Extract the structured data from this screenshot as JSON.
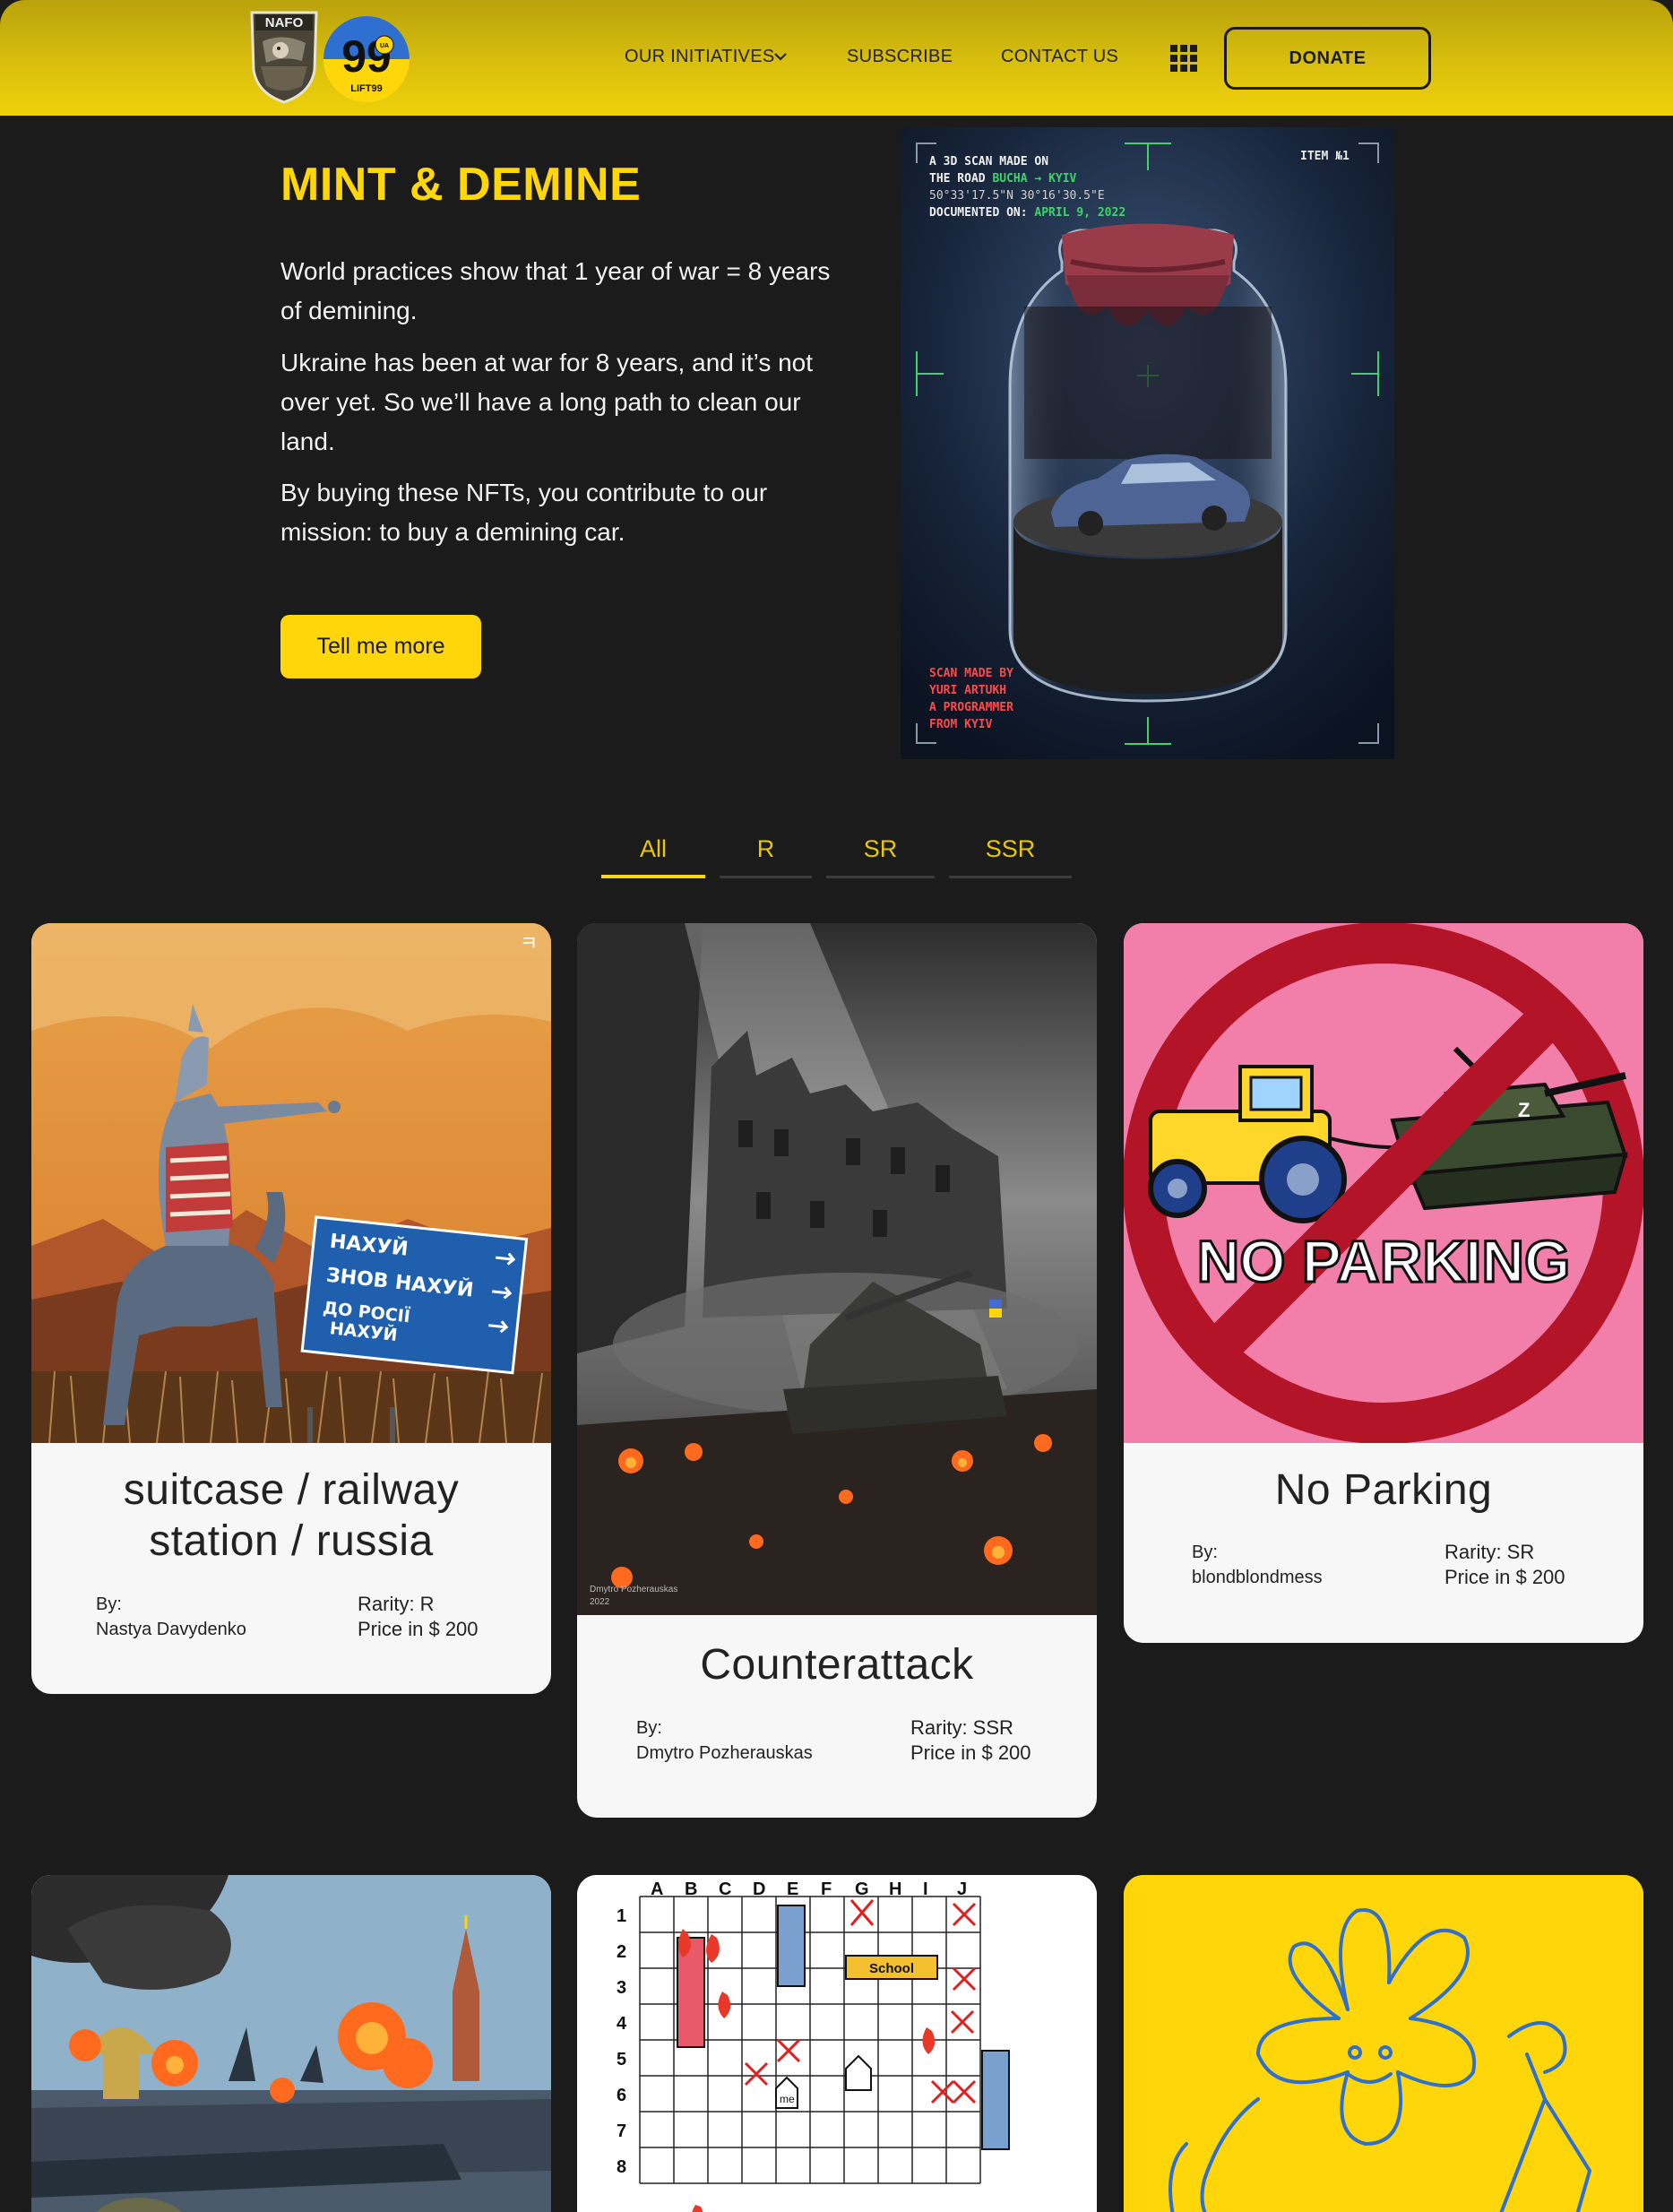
{
  "header": {
    "logo_nafo_text": "NAFO",
    "logo_lift_text": "LIFT99",
    "nav": {
      "initiatives": "OUR INITIATIVES",
      "subscribe": "SUBSCRIBE",
      "contact": "CONTACT US"
    },
    "donate_label": "DONATE",
    "accent_color": "#ffd60a"
  },
  "hero": {
    "title": "MINT & DEMINE",
    "paragraphs": [
      "World practices show that 1 year of war = 8 years of demining.",
      "Ukraine has been at war for 8 years, and it’s not over yet. So we’ll have a long path to clean our land.",
      "By buying these NFTs, you contribute to our mission: to buy a demining car."
    ],
    "cta_label": "Tell me more",
    "scan": {
      "item_no": "ITEM №1",
      "line1": "A 3D SCAN MADE ON",
      "line2_prefix": "THE ROAD ",
      "line2_route": "BUCHA → KYIV",
      "line3": "50°33'17.5\"N 30°16'30.5\"E",
      "line4_prefix": "DOCUMENTED ON: ",
      "line4_date": "APRIL 9, 2022",
      "credit1": "SCAN MADE BY",
      "credit2": "YURI ARTUKH",
      "credit3": "A PROGRAMMER",
      "credit4": "FROM KYIV"
    }
  },
  "filters": [
    "All",
    "R",
    "SR",
    "SSR"
  ],
  "cards": [
    {
      "title": "suitcase / railway station / russia",
      "title_line1": "suitcase / railway",
      "title_line2": "station / russia",
      "by_label": "By:",
      "author": "Nastya Davydenko",
      "rarity": "Rarity: R",
      "price": "Price in $ 200",
      "sign_text": [
        "НАХУЙ",
        "ЗНОВ НАХУЙ",
        "ДО РОСІЇ",
        "НАХУЙ"
      ]
    },
    {
      "title": "Counterattack",
      "by_label": "By:",
      "author": "Dmytro Pozherauskas",
      "rarity": "Rarity: SSR",
      "price": "Price in $ 200",
      "signature": "Dmytro Pozherauskas",
      "signature_year": "2022"
    },
    {
      "title": "No Parking",
      "by_label": "By:",
      "author": "blondblondmess",
      "rarity": "Rarity: SR",
      "price": "Price in $ 200",
      "art_text": "NO PARKING"
    },
    {
      "art": "burning-kremlin"
    },
    {
      "art": "battleship-grid",
      "cols": [
        "A",
        "B",
        "C",
        "D",
        "E",
        "F",
        "G",
        "H",
        "I",
        "J"
      ],
      "rows": [
        "1",
        "2",
        "3",
        "4",
        "5",
        "6",
        "7",
        "8"
      ],
      "school_label": "School",
      "me_label": "me"
    },
    {
      "art": "flower-doodle",
      "bg_color": "#ffd60a"
    }
  ]
}
